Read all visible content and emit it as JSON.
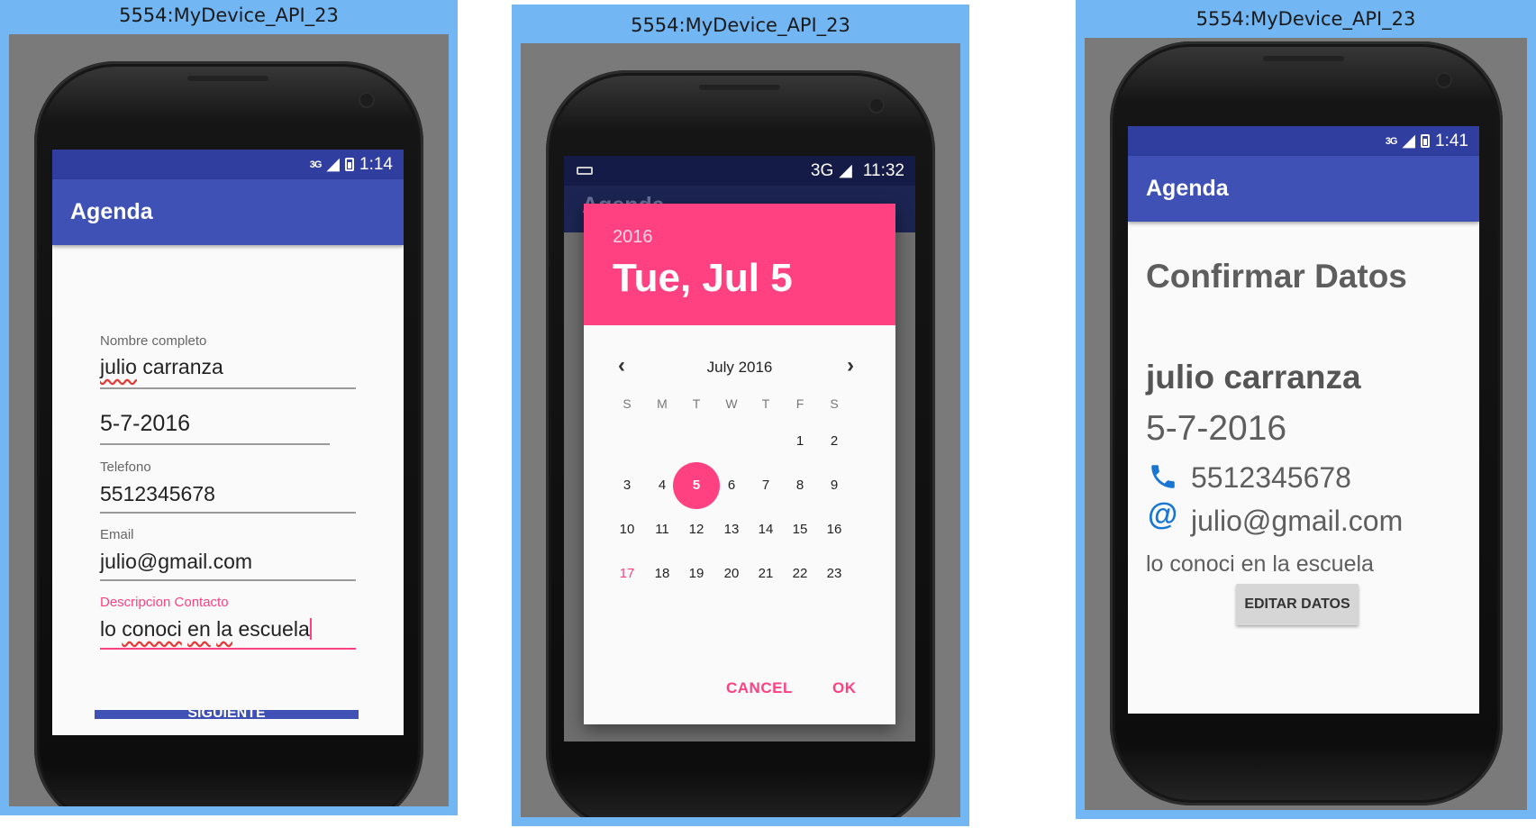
{
  "emulators": [
    {
      "window_title": "5554:MyDevice_API_23",
      "status_time": "1:14",
      "network": "3G",
      "app_title": "Agenda",
      "form": {
        "name_label": "Nombre completo",
        "name_value": "julio carranza",
        "date_value": "5-7-2016",
        "phone_label": "Telefono",
        "phone_value": "5512345678",
        "email_label": "Email",
        "email_value": "julio@gmail.com",
        "desc_label": "Descripcion Contacto",
        "desc_words": [
          "lo",
          "conoci",
          "en",
          "la",
          "escuela"
        ],
        "next_button": "SIGUIENTE"
      }
    },
    {
      "window_title": "5554:MyDevice_API_23",
      "status_time": "11:32",
      "network": "3G",
      "app_title": "Agenda",
      "date_picker": {
        "year": "2016",
        "selected_date": "Tue, Jul 5",
        "month_label": "July 2016",
        "weekdays": [
          "S",
          "M",
          "T",
          "W",
          "T",
          "F",
          "S"
        ],
        "selected_day": "5",
        "today_day": "17",
        "weeks": [
          [
            "",
            "",
            "",
            "",
            "",
            "1",
            "2"
          ],
          [
            "3",
            "4",
            "5",
            "6",
            "7",
            "8",
            "9"
          ],
          [
            "10",
            "11",
            "12",
            "13",
            "14",
            "15",
            "16"
          ],
          [
            "17",
            "18",
            "19",
            "20",
            "21",
            "22",
            "23"
          ]
        ],
        "cancel_label": "CANCEL",
        "ok_label": "OK"
      }
    },
    {
      "window_title": "5554:MyDevice_API_23",
      "status_time": "1:41",
      "network": "3G",
      "app_title": "Agenda",
      "confirm": {
        "title": "Confirmar Datos",
        "name": "julio carranza",
        "date": "5-7-2016",
        "phone": "5512345678",
        "email": "julio@gmail.com",
        "description": "lo conoci en la escuela",
        "edit_button": "EDITAR DATOS"
      }
    }
  ],
  "icons": {
    "prev_month": "chevron-left-icon",
    "next_month": "chevron-right-icon",
    "phone": "phone-icon",
    "email": "at-sign-icon"
  },
  "colors": {
    "emulator_frame": "#72b6f4",
    "primary_dark": "#303f9f",
    "primary": "#3f51b5",
    "accent": "#ff4081",
    "contact_icon": "#1976d2"
  }
}
